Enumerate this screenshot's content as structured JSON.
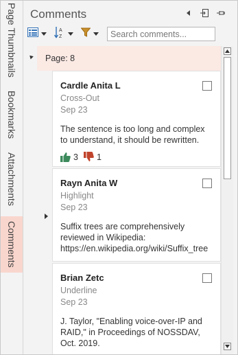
{
  "side_tabs": [
    {
      "label": "Page Thumbnails",
      "active": false
    },
    {
      "label": "Bookmarks",
      "active": false
    },
    {
      "label": "Attachments",
      "active": false
    },
    {
      "label": "Comments",
      "active": true
    }
  ],
  "panel": {
    "title": "Comments",
    "header_icons": [
      "collapse-left-icon",
      "undock-icon",
      "pin-icon"
    ],
    "toolbar": {
      "view_icon": "list-view-icon",
      "sort_icon": "sort-az-icon",
      "filter_icon": "filter-icon",
      "search_placeholder": "Search comments..."
    }
  },
  "page_group": {
    "label": "Page: 8"
  },
  "comments": [
    {
      "author": "Cardle Anita L",
      "type": "Cross-Out",
      "date": "Sep 23",
      "text": "The sentence is too long and complex to understand, it should be rewritten.",
      "likes": "3",
      "dislikes": "1"
    },
    {
      "author": "Rayn Anita W",
      "type": "Highlight",
      "date": "Sep 23",
      "text": "Suffix trees are comprehensively reviewed in Wikipedia: https://en.wikipedia.org/wiki/Suffix_tree"
    },
    {
      "author": "Brian Zetc",
      "type": "Underline",
      "date": "Sep 23",
      "text": "J. Taylor, \"Enabling voice-over-IP and RAID,\" in Proceedings of NOSSDAV, Oct. 2019."
    }
  ],
  "colors": {
    "active_tab": "#f9d6cd",
    "page_label_bg": "#fbe9e4",
    "like": "#3c8a5c",
    "dislike": "#c0442c",
    "filter": "#c8902c",
    "list_icon": "#2f6fb5"
  }
}
